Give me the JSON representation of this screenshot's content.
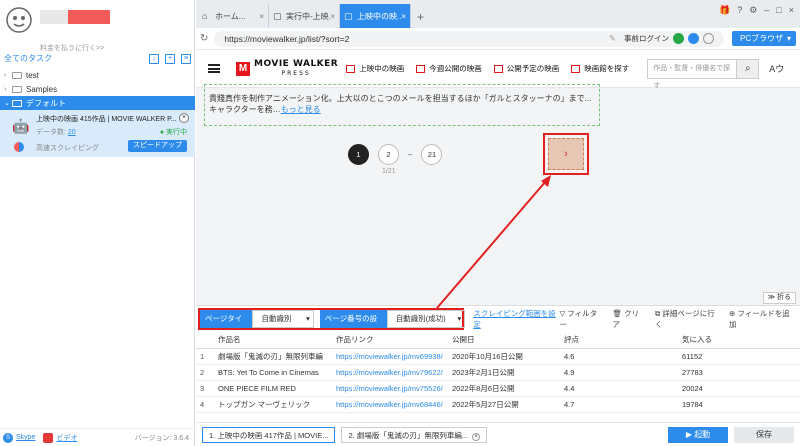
{
  "sidebar": {
    "upgrade_link": "料金を払うに行く>>",
    "all_tasks": "全てのタスク",
    "tree": [
      {
        "arrow": "›",
        "label": "test"
      },
      {
        "arrow": "›",
        "label": "Samples"
      },
      {
        "arrow": "⌄",
        "label": "デフォルト"
      }
    ],
    "task": {
      "title": "上映中の映画 415作品 | MOVIE WALKER P...",
      "count_label": "データ数:",
      "count_value": "20",
      "status": "● 実行中",
      "speed_text": "高速スクレイピング",
      "speed_button": "スピードアップ"
    },
    "footer": {
      "skype": "Skype",
      "video": "ビデオ",
      "version": "バージョン: 3.6.4"
    }
  },
  "browser": {
    "tabs": [
      {
        "label": "ホーム...",
        "icon": "⌂"
      },
      {
        "label": "実行中-上映...",
        "icon": "▢"
      },
      {
        "label": "上映中の映...",
        "icon": "▢"
      }
    ],
    "url": "https://moviewalker.jp/list/?sort=2",
    "login_label": "事前ログイン",
    "pc_browser": "PCブラウザ",
    "site": {
      "logo_main": "MOVIE WALKER",
      "logo_sub": "PRESS",
      "nav": [
        "上映中の映画",
        "今週公開の映画",
        "公開予定の映画",
        "映画館を探す"
      ],
      "search_placeholder": "作品・監督・俳優名で探す",
      "user_glyph": "Aウ",
      "snippet_line1": "貴賤真作を制作アニメーション化。上大以のとこつのメールを担当するほか「ガルとスタッーナの」まで...",
      "snippet_line2": "キャラクターを務…",
      "snippet_more": "もっと見る",
      "pages": [
        "1",
        "2",
        "–",
        "21"
      ],
      "page_info": "1/21",
      "next_glyph": "›"
    },
    "collapse": "折る"
  },
  "panel": {
    "page_type_label": "ページタイプ",
    "page_type_value": "自動識別",
    "page_num_label": "ページ番号の設定",
    "page_num_value": "自動識別(成功)",
    "scraping_range": "スクレイピング範囲を設定",
    "tools": [
      "▽ フィルター",
      "🗑 クリア",
      "⧉ 詳細ページに行く",
      "⊕ フィールドを追加"
    ],
    "columns": [
      "",
      "作品名",
      "作品リンク",
      "公開日",
      "評点",
      "気に入る"
    ],
    "rows": [
      [
        "1",
        "劇場版「鬼滅の刃」無限列車編",
        "https://moviewalker.jp/mv69938/",
        "2020年10月16日公開",
        "4.6",
        "61152"
      ],
      [
        "2",
        "BTS: Yet To Come in Cinemas",
        "https://moviewalker.jp/mv79622/",
        "2023年2月1日公開",
        "4.9",
        "27783"
      ],
      [
        "3",
        "ONE PIECE FILM RED",
        "https://moviewalker.jp/mv75526/",
        "2022年8月6日公開",
        "4.4",
        "20024"
      ],
      [
        "4",
        "トップガン マーヴェリック",
        "https://moviewalker.jp/mv68446/",
        "2022年5月27日公開",
        "4.7",
        "19784"
      ]
    ],
    "bottom_tabs": [
      "1. 上映中の映画 417作品 | MOVIE...",
      "2. 劇場版「鬼滅の刃」無限列車編..."
    ],
    "start": "▶ 起動",
    "save": "保存"
  }
}
